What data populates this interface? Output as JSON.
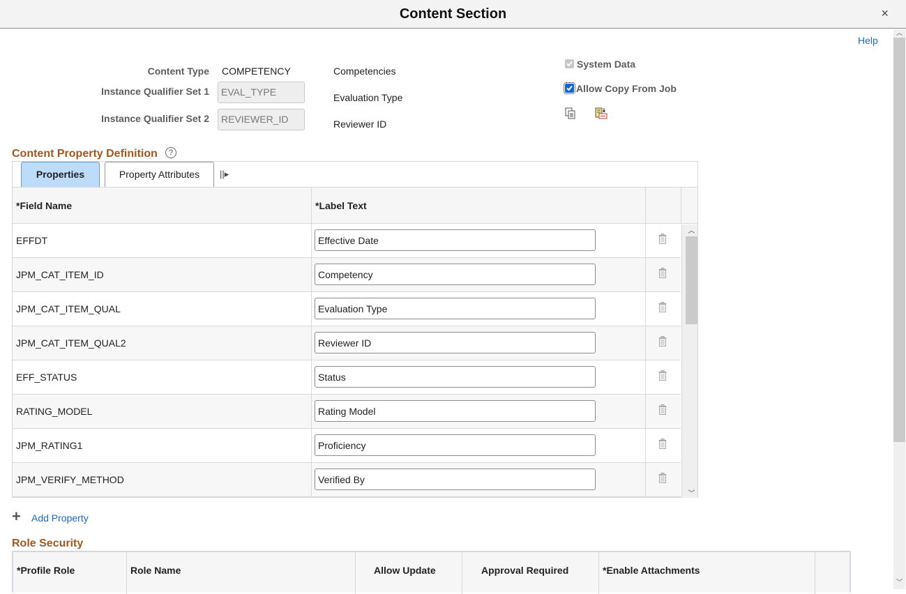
{
  "window": {
    "title": "Content Section",
    "close_label": "×"
  },
  "help_label": "Help",
  "header_fields": {
    "content_type_label": "Content Type",
    "content_type_value": "COMPETENCY",
    "content_type_desc": "Competencies",
    "iq_set1_label": "Instance Qualifier Set 1",
    "iq_set1_value": "EVAL_TYPE",
    "iq_set1_desc": "Evaluation Type",
    "iq_set2_label": "Instance Qualifier Set 2",
    "iq_set2_value": "REVIEWER_ID",
    "iq_set2_desc": "Reviewer ID"
  },
  "checkboxes": {
    "system_data": {
      "label": "System Data",
      "checked": true,
      "disabled": true
    },
    "allow_copy": {
      "label": "Allow Copy From Job",
      "checked": true,
      "disabled": false
    }
  },
  "icons": {
    "copy": "copy-icon",
    "paste": "paste-list-icon"
  },
  "property_section": {
    "title": "Content Property Definition",
    "help_icon": "?",
    "tabs": [
      {
        "label": "Properties",
        "active": true
      },
      {
        "label": "Property Attributes",
        "active": false
      }
    ],
    "tab_more_glyph": "||▸",
    "columns": [
      "*Field Name",
      "*Label Text"
    ],
    "rows": [
      {
        "field": "EFFDT",
        "label": "Effective Date"
      },
      {
        "field": "JPM_CAT_ITEM_ID",
        "label": "Competency"
      },
      {
        "field": "JPM_CAT_ITEM_QUAL",
        "label": "Evaluation Type"
      },
      {
        "field": "JPM_CAT_ITEM_QUAL2",
        "label": "Reviewer ID"
      },
      {
        "field": "EFF_STATUS",
        "label": "Status"
      },
      {
        "field": "RATING_MODEL",
        "label": "Rating Model"
      },
      {
        "field": "JPM_RATING1",
        "label": "Proficiency"
      },
      {
        "field": "JPM_VERIFY_METHOD",
        "label": "Verified By"
      }
    ],
    "add_label": "Add Property"
  },
  "role_security": {
    "title": "Role Security",
    "columns": [
      "*Profile Role",
      "Role Name",
      "Allow Update",
      "Approval Required",
      "*Enable Attachments"
    ]
  }
}
